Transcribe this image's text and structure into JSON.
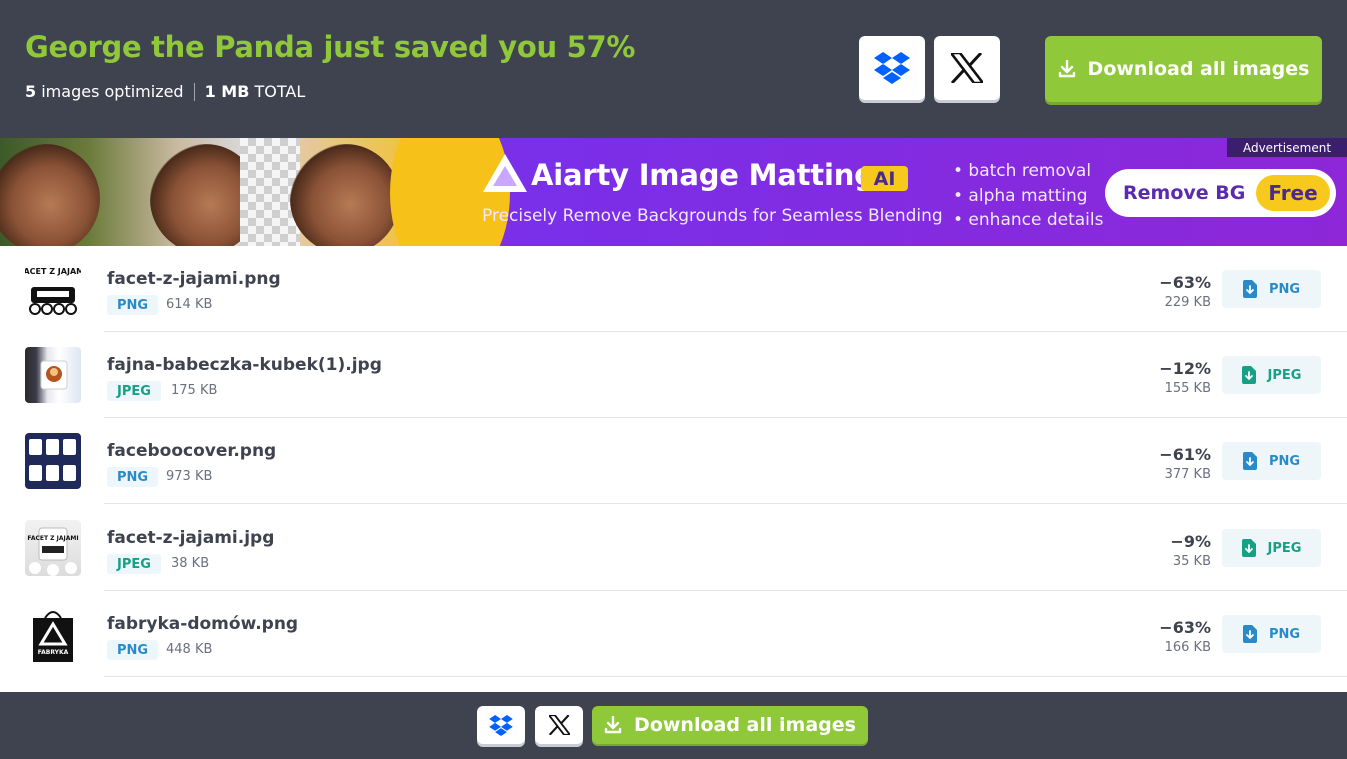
{
  "header": {
    "headline": "George the Panda just saved you 57%",
    "image_count": "5",
    "images_label": "images optimized",
    "total_size": "1 MB",
    "total_label": "TOTAL",
    "download_all_label": "Download all images",
    "share_icons": [
      "dropbox-icon",
      "x-icon"
    ]
  },
  "ad": {
    "title": "Aiarty Image Matting",
    "ai_badge": "AI",
    "subtitle": "Precisely Remove Backgrounds for Seamless Blending",
    "bullets": [
      "• batch removal",
      "• alpha matting",
      "• enhance details"
    ],
    "cta_label": "Remove BG",
    "cta_badge": "Free",
    "ad_label": "Advertisement"
  },
  "files": [
    {
      "name": "facet-z-jajami.png",
      "type": "PNG",
      "original_size": "614 KB",
      "savings": "−63%",
      "new_size": "229 KB",
      "button_label": "PNG",
      "thumb_text": "FACET Z JAJAMI"
    },
    {
      "name": "fajna-babeczka-kubek(1).jpg",
      "type": "JPEG",
      "original_size": "175 KB",
      "savings": "−12%",
      "new_size": "155 KB",
      "button_label": "JPEG",
      "thumb_text": ""
    },
    {
      "name": "faceboocover.png",
      "type": "PNG",
      "original_size": "973 KB",
      "savings": "−61%",
      "new_size": "377 KB",
      "button_label": "PNG",
      "thumb_text": ""
    },
    {
      "name": "facet-z-jajami.jpg",
      "type": "JPEG",
      "original_size": "38 KB",
      "savings": "−9%",
      "new_size": "35 KB",
      "button_label": "JPEG",
      "thumb_text": "FACET Z JAJAMI"
    },
    {
      "name": "fabryka-domów.png",
      "type": "PNG",
      "original_size": "448 KB",
      "savings": "−63%",
      "new_size": "166 KB",
      "button_label": "PNG",
      "thumb_text": "FABRYKA"
    }
  ],
  "footer": {
    "download_all_label": "Download all images"
  },
  "colors": {
    "header_bg": "#3f4350",
    "accent_green": "#8fc93a",
    "png_blue": "#2a8ac9",
    "jpeg_teal": "#16a085",
    "ad_purple": "#8a3cf0",
    "ad_yellow": "#f7c91c"
  }
}
